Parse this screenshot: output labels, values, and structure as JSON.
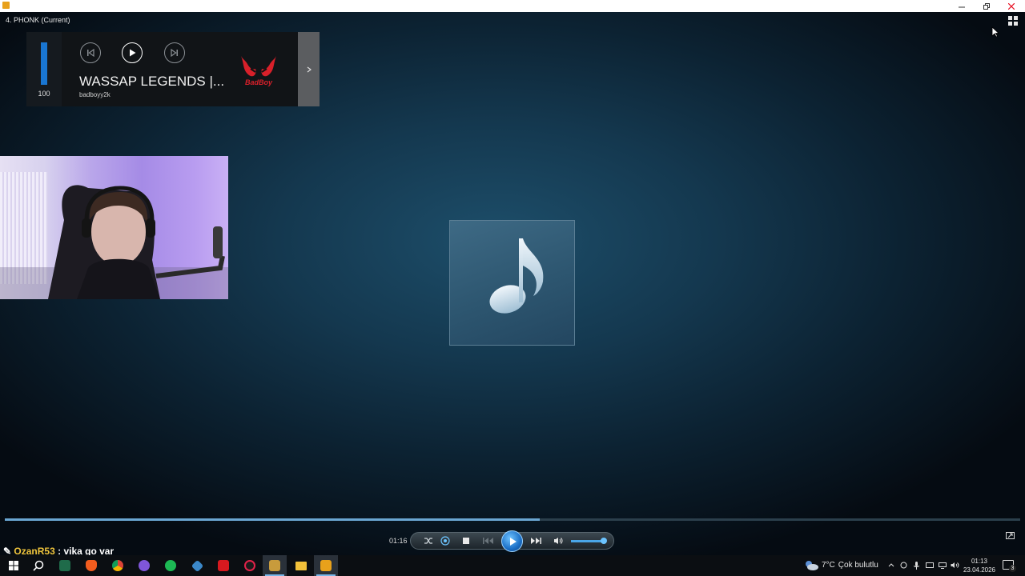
{
  "window": {
    "playlist_label": "4. PHONK (Current)"
  },
  "mini_player": {
    "volume_value": "100",
    "volume_level": 1.0,
    "title": "WASSAP LEGENDS |...",
    "artist": "badboyy2k",
    "logo_text": "BadBoy",
    "icons": {
      "previous": "previous-track-icon",
      "play": "play-icon",
      "next": "next-track-icon",
      "expand": "chevron-right-icon"
    }
  },
  "album_art": {
    "icon": "music-note-icon"
  },
  "playback": {
    "elapsed": "01:16",
    "progress": 0.527,
    "volume_level": 0.9
  },
  "chat": {
    "user": "OzanR53",
    "separator": " : ",
    "message": "vika go var"
  },
  "taskbar": {
    "weather_temp": "7°C",
    "weather_desc": "Çok bulutlu",
    "time": "01:13",
    "date": "23.04.2026",
    "notification_count": "3",
    "apps": [
      "start",
      "search",
      "league-client",
      "brave",
      "chrome",
      "discord",
      "spotify",
      "vpn",
      "amd",
      "opera-gx",
      "league-of-legends",
      "file-explorer",
      "media-player"
    ]
  },
  "colors": {
    "accent": "#1976d2",
    "progress": "#6aa6d2",
    "chat_user": "#f0c53c",
    "close": "#e81123"
  }
}
